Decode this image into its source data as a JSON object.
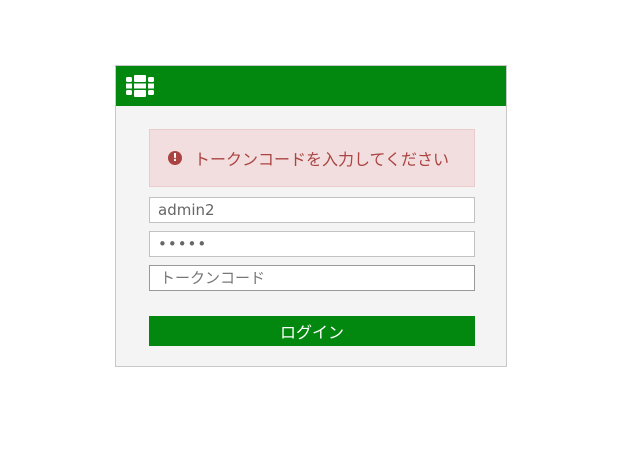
{
  "header": {
    "logo_icon": "fortinet-logo-icon",
    "background_color": "#02870f"
  },
  "alert": {
    "icon": "exclamation-circle-icon",
    "message": "トークンコードを入力してください",
    "text_color": "#a94442",
    "background_color": "#f2dede"
  },
  "form": {
    "username_value": "admin2",
    "password_value": "admin",
    "token_placeholder": "トークンコード",
    "login_label": "ログイン",
    "button_color": "#02870f"
  }
}
